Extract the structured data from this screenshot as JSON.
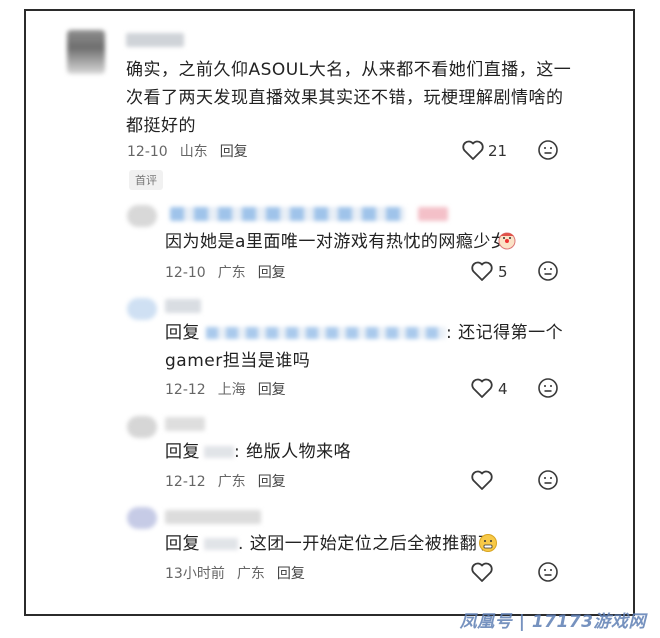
{
  "comments": [
    {
      "text_lines": [
        "确实，之前久仰ASOUL大名，从来都不看她们直播，这一",
        "次看了两天发现直播效果其实还不错，玩梗理解剧情啥的",
        "都挺好的"
      ],
      "date": "12-10",
      "location": "山东",
      "reply_label": "回复",
      "likes": "21",
      "badge": "首评"
    },
    {
      "text": "因为她是a里面唯一对游戏有热忱的网瘾少女",
      "date": "12-10",
      "location": "广东",
      "reply_label": "回复",
      "likes": "5",
      "emoji": "clown-face-icon"
    },
    {
      "reply_prefix": "回复",
      "text_suffix": ": 还记得第一个",
      "text_line2": "gamer担当是谁吗",
      "date": "12-12",
      "location": "上海",
      "reply_label": "回复",
      "likes": "4"
    },
    {
      "reply_prefix": "回复",
      "text_suffix": ": 绝版人物来咯",
      "date": "12-12",
      "location": "广东",
      "reply_label": "回复"
    },
    {
      "reply_prefix": "回复",
      "text_suffix": ". 这团一开始定位之后全被推翻了",
      "date": "13小时前",
      "location": "广东",
      "reply_label": "回复",
      "emoji": "grimacing-face-icon"
    }
  ],
  "watermark": "凤凰号 | 17173游戏网",
  "colors": {
    "like_icon": "#3a3a3a",
    "meta_text": "#666666",
    "watermark": "#5f7fb5"
  }
}
